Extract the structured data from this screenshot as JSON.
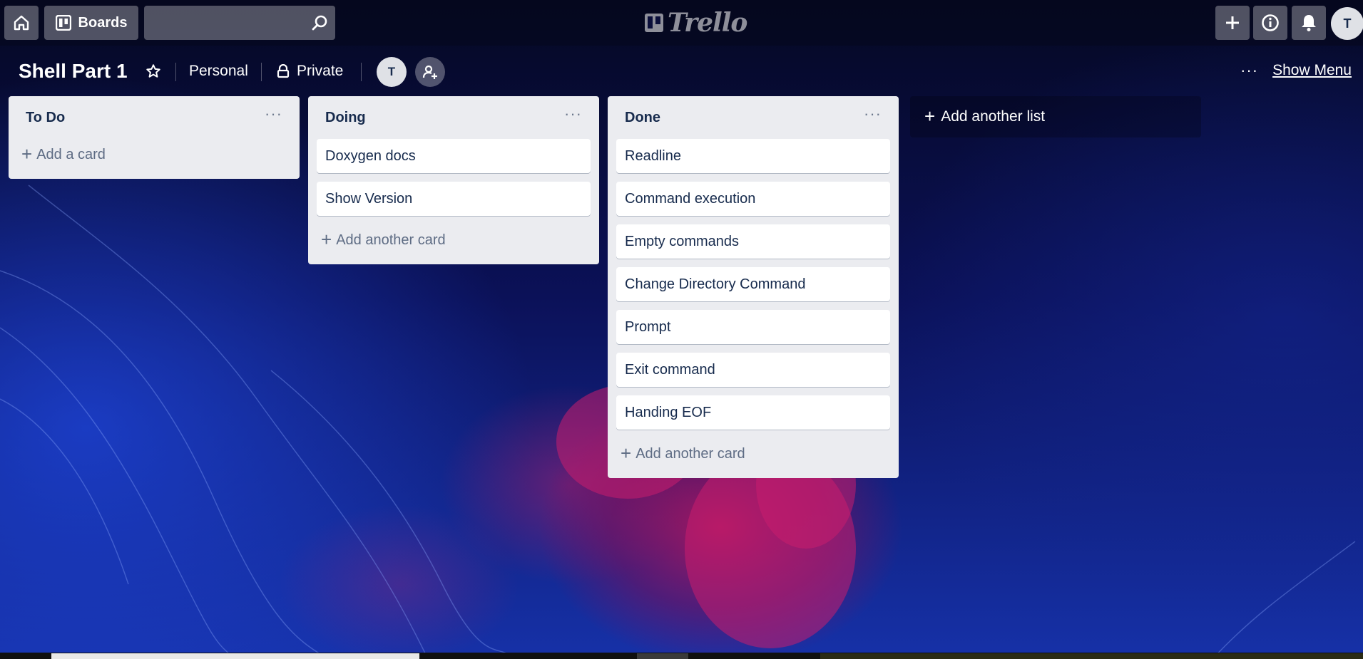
{
  "topbar": {
    "home_icon": "home-icon",
    "boards_label": "Boards",
    "search_placeholder": "",
    "logo_text": "Trello",
    "avatar_initial": "T"
  },
  "board": {
    "title": "Shell Part 1",
    "visibility_team": "Personal",
    "visibility_privacy": "Private",
    "member_initial": "T",
    "show_menu_label": "Show Menu"
  },
  "lists": [
    {
      "title": "To Do",
      "cards": [],
      "add_label": "Add a card"
    },
    {
      "title": "Doing",
      "cards": [
        "Doxygen docs",
        "Show Version"
      ],
      "add_label": "Add another card"
    },
    {
      "title": "Done",
      "cards": [
        "Readline",
        "Command execution",
        "Empty commands",
        "Change Directory Command",
        "Prompt",
        "Exit command",
        "Handing EOF"
      ],
      "add_label": "Add another card"
    }
  ],
  "add_list_label": "Add another list",
  "colors": {
    "list_bg": "#ebecf0",
    "card_bg": "#ffffff",
    "text": "#172b4d",
    "muted": "#5e6c84"
  }
}
